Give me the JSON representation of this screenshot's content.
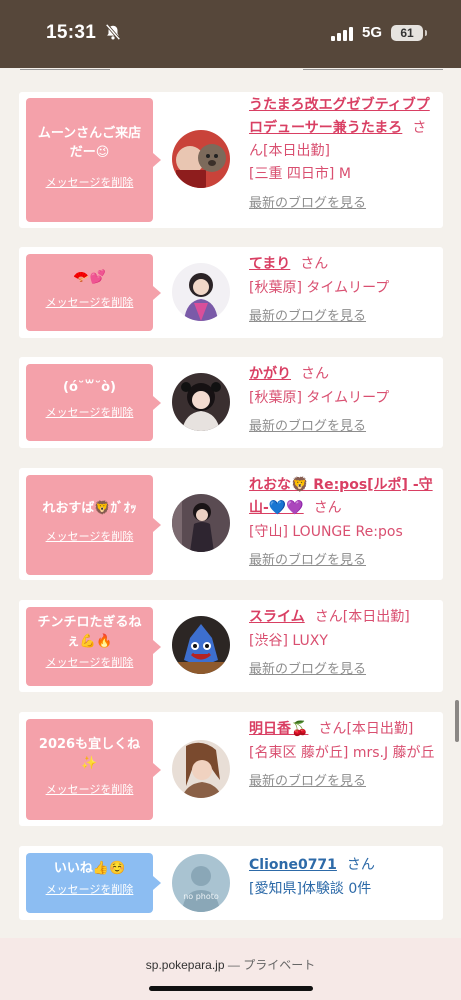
{
  "status": {
    "time": "15:31",
    "network": "5G",
    "battery": "61"
  },
  "cards": [
    {
      "message": "ムーンさんご来店だー😉",
      "delete_label": "メッセージを削除",
      "name": "うたまろ改エグゼブティブプロデューサー兼うたまろ",
      "san": "さん",
      "tag": "[本日出勤]",
      "location": "[三重 四日市] M",
      "blog": "最新のブログを見る",
      "avatar_color": "#b8322d"
    },
    {
      "message": "🪭💕",
      "delete_label": "メッセージを削除",
      "name": "てまり",
      "san": "さん",
      "tag": "",
      "location": "[秋葉原] タイムリープ",
      "blog": "最新のブログを見る",
      "avatar_color": "#7a5aa8"
    },
    {
      "message": "(ó˘꒳˘ò)",
      "delete_label": "メッセージを削除",
      "name": "かがり",
      "san": "さん",
      "tag": "",
      "location": "[秋葉原] タイムリープ",
      "blog": "最新のブログを見る",
      "avatar_color": "#3a2a2a"
    },
    {
      "message": "れおすば🦁ｶﾞｵｯ",
      "delete_label": "メッセージを削除",
      "name": "れおな🦁 Re:pos[ルポ] -守山-💙💜",
      "san": "さん",
      "tag": "",
      "location": "[守山] LOUNGE Re:pos",
      "blog": "最新のブログを見る",
      "avatar_color": "#4a3f46"
    },
    {
      "message": "チンチロたぎるねぇ💪🔥",
      "delete_label": "メッセージを削除",
      "name": "スライム",
      "san": "さん",
      "tag": "[本日出勤]",
      "location": "[渋谷] LUXY",
      "blog": "最新のブログを見る",
      "avatar_color": "#3558a8"
    },
    {
      "message": "2026も宜しくね✨",
      "delete_label": "メッセージを削除",
      "name": "明日香🍒",
      "san": "さん",
      "tag": "[本日出勤]",
      "location": "[名東区 藤が丘] mrs.J 藤が丘",
      "blog": "最新のブログを見る",
      "avatar_color": "#8a6046"
    },
    {
      "message": "いいね👍☺️",
      "delete_label": "メッセージを削除",
      "name": "Clione0771",
      "san": "さん",
      "tag": "",
      "location": "[愛知県]体験談 0件",
      "blog": "",
      "avatar_color": "#a9c3d1",
      "avatar_text": "no photo"
    }
  ],
  "browser": {
    "domain": "sp.pokepara.jp",
    "separator": "—",
    "mode": "プライベート"
  }
}
